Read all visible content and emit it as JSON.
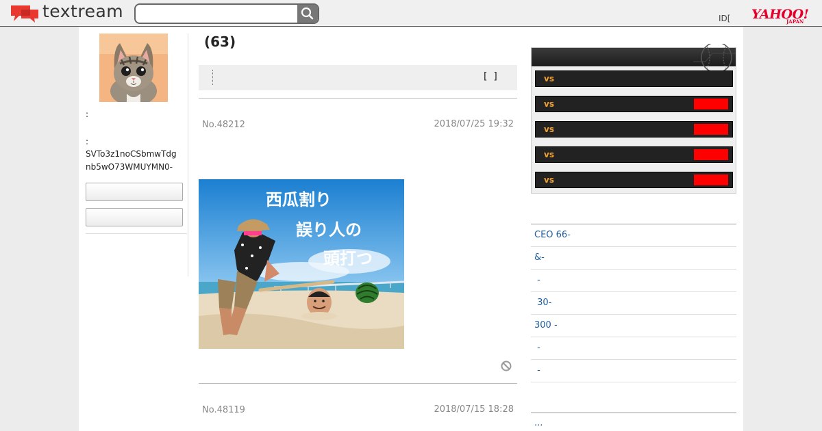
{
  "header": {
    "logo_text": "textream",
    "search": {
      "value": "",
      "placeholder": ""
    },
    "id_text": "ID[",
    "yahoo_text": "YAHOO!",
    "yahoo_sub": "JAPAN"
  },
  "profile": {
    "label1": ":",
    "label2": ":",
    "user_id": "SVTo3z1noCSbmwTdgnb5wO73WMUYMN0-",
    "button1_label": "",
    "button2_label": ""
  },
  "thread": {
    "post_count": "(63)",
    "toolbar_bracket": "[  ]"
  },
  "posts": [
    {
      "number": "No.48212",
      "date": "2018/07/25 19:32",
      "image_text": [
        "西瓜割り",
        "誤り人の",
        "頭打つ"
      ]
    },
    {
      "number": "No.48119",
      "date": "2018/07/15 18:28"
    }
  ],
  "sports": {
    "games": [
      {
        "vs": "vs",
        "has_score": false
      },
      {
        "vs": "vs",
        "has_score": true
      },
      {
        "vs": "vs",
        "has_score": true
      },
      {
        "vs": "vs",
        "has_score": true
      },
      {
        "vs": "vs",
        "has_score": true
      }
    ]
  },
  "topics": [
    "CEO 66-",
    "&-",
    " -",
    " 30-",
    "300 -",
    " -",
    " -"
  ],
  "more_link": "...",
  "colors": {
    "header_bg": "#f0f0f0",
    "logo_red": "#e8382f",
    "yahoo_red": "#e4002b",
    "link_blue": "#1d5ea0",
    "vs_orange": "#f0a030",
    "score_red": "#ff0000"
  },
  "icons": [
    "speech-bubble-logo-icon",
    "search-icon",
    "ban-icon"
  ]
}
